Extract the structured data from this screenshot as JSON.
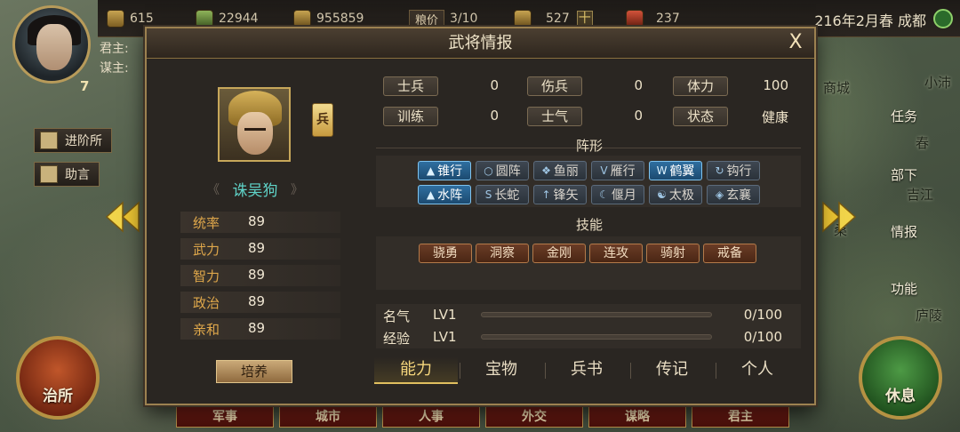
{
  "topbar": {
    "resources": [
      {
        "icon": "gold-icon",
        "value": "615"
      },
      {
        "icon": "grain-icon",
        "value": "22944"
      },
      {
        "icon": "troops-icon",
        "value": "955859"
      }
    ],
    "grain_price_label": "粮价",
    "grain_price_value": "3/10",
    "coin_value": "527",
    "plus_label": "十",
    "token_value": "237",
    "date": "216年2月春 成都"
  },
  "lord": {
    "lord_label": "君主:",
    "advisor_label": "谋主:",
    "level": "7"
  },
  "side_buttons": {
    "advance": "进阶所",
    "advice": "助言"
  },
  "map_labels": [
    "商城",
    "小沛",
    "任务",
    "春",
    "部下",
    "吉江",
    "情报",
    "桑",
    "功能",
    "庐陵"
  ],
  "round_buttons": {
    "govern": "治所",
    "rest": "休息"
  },
  "bottom_menu": [
    "军事",
    "城市",
    "人事",
    "外交",
    "谋略",
    "君主"
  ],
  "dialog": {
    "title": "武将情报",
    "close": "X",
    "general": {
      "name": "诛吴狗",
      "class_badge": "兵",
      "stats": [
        {
          "label": "统率",
          "value": "89"
        },
        {
          "label": "武力",
          "value": "89"
        },
        {
          "label": "智力",
          "value": "89"
        },
        {
          "label": "政治",
          "value": "89"
        },
        {
          "label": "亲和",
          "value": "89"
        }
      ],
      "cultivate": "培养"
    },
    "status": [
      {
        "label": "士兵",
        "value": "0"
      },
      {
        "label": "伤兵",
        "value": "0"
      },
      {
        "label": "体力",
        "value": "100"
      },
      {
        "label": "训练",
        "value": "0"
      },
      {
        "label": "士气",
        "value": "0"
      },
      {
        "label": "状态",
        "value": "健康"
      }
    ],
    "formation_title": "阵形",
    "formations": [
      {
        "icon": "▲",
        "label": "锥行",
        "active": true
      },
      {
        "icon": "○",
        "label": "圆阵",
        "active": false
      },
      {
        "icon": "❖",
        "label": "鱼丽",
        "active": false
      },
      {
        "icon": "V",
        "label": "雁行",
        "active": false
      },
      {
        "icon": "W",
        "label": "鹤翼",
        "active": true
      },
      {
        "icon": "↻",
        "label": "钩行",
        "active": false
      },
      {
        "icon": "▲",
        "label": "水阵",
        "active": true
      },
      {
        "icon": "S",
        "label": "长蛇",
        "active": false
      },
      {
        "icon": "↑",
        "label": "锋矢",
        "active": false
      },
      {
        "icon": "☾",
        "label": "偃月",
        "active": false
      },
      {
        "icon": "☯",
        "label": "太极",
        "active": false
      },
      {
        "icon": "◈",
        "label": "玄襄",
        "active": false
      }
    ],
    "skill_title": "技能",
    "skills": [
      "骁勇",
      "洞察",
      "金刚",
      "连攻",
      "骑射",
      "戒备"
    ],
    "fame": {
      "label": "名气",
      "level": "LV1",
      "value": "0/100",
      "progress": 0
    },
    "exp": {
      "label": "经验",
      "level": "LV1",
      "value": "0/100",
      "progress": 0
    },
    "tabs": [
      {
        "label": "能力",
        "active": true
      },
      {
        "label": "宝物",
        "active": false
      },
      {
        "label": "兵书",
        "active": false
      },
      {
        "label": "传记",
        "active": false
      },
      {
        "label": "个人",
        "active": false
      }
    ]
  },
  "colors": {
    "accent_gold": "#e0bf5f",
    "formation_active": "#2f6fa0",
    "stat_label": "#e0a84b",
    "general_name": "#5fd3c8"
  }
}
